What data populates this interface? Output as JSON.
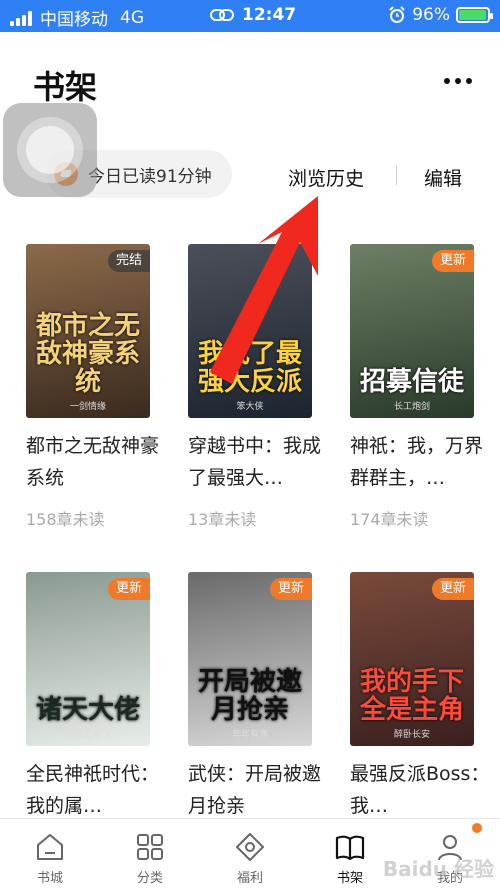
{
  "status": {
    "carrier": "中国移动",
    "network": "4G",
    "time": "12:47",
    "battery": "96%",
    "battery_level": 0.96
  },
  "header": {
    "title": "书架",
    "more_icon": "more-dots-icon"
  },
  "reading": {
    "text": "今日已读91分钟"
  },
  "actions": {
    "history": "浏览历史",
    "edit": "编辑"
  },
  "books": [
    {
      "cover_title": "都市之无敌神豪系统",
      "cover_author": "一剑情缘",
      "tag": "完结",
      "tag_type": "done",
      "title": "都市之无敌神豪系统",
      "unread": "158章未读",
      "colors": [
        "#3a2a1e",
        "#8c6a4a"
      ],
      "title_color": "#f4d27a"
    },
    {
      "cover_title": "我成了最强大反派",
      "cover_author": "笨大侠",
      "tag": "",
      "tag_type": "",
      "title": "穿越书中：我成了最强大…",
      "unread": "13章未读",
      "colors": [
        "#1c2430",
        "#4b4f58"
      ],
      "title_color": "#ffd23a"
    },
    {
      "cover_title": "招募信徒",
      "cover_author": "长工炮剑",
      "tag": "更新",
      "tag_type": "update",
      "title": "神祇：我，万界群群主，…",
      "unread": "174章未读",
      "colors": [
        "#2a3a2a",
        "#6e7f66"
      ],
      "title_color": "#ffffff"
    },
    {
      "cover_title": "诸天大佬",
      "cover_author": "混沌之乖飞",
      "tag": "更新",
      "tag_type": "update",
      "title": "全民神祇时代：我的属…",
      "unread": "",
      "colors": [
        "#e8ede9",
        "#8a9a90"
      ],
      "title_color": "#1a2a1e"
    },
    {
      "cover_title": "开局被邀月抢亲",
      "cover_author": "年年有渔",
      "tag": "更新",
      "tag_type": "update",
      "title": "武侠：开局被邀月抢亲",
      "unread": "",
      "colors": [
        "#d8d8d8",
        "#6a6a6a"
      ],
      "title_color": "#111111"
    },
    {
      "cover_title": "我的手下全是主角",
      "cover_author": "醉卧长安",
      "tag": "更新",
      "tag_type": "update",
      "title": "最强反派Boss：我…",
      "unread": "",
      "colors": [
        "#3a2020",
        "#7a4a3a"
      ],
      "title_color": "#ff4a3a"
    }
  ],
  "nav": [
    {
      "label": "书城",
      "icon": "home-icon"
    },
    {
      "label": "分类",
      "icon": "grid-icon"
    },
    {
      "label": "福利",
      "icon": "gift-icon"
    },
    {
      "label": "书架",
      "icon": "book-icon",
      "active": true
    },
    {
      "label": "我的",
      "icon": "user-icon",
      "dot": true
    }
  ],
  "watermark": "Baidu 经验",
  "colors": {
    "statusbar": "#2f7ff5",
    "accent": "#f07a2a",
    "arrow": "#f0281e"
  }
}
